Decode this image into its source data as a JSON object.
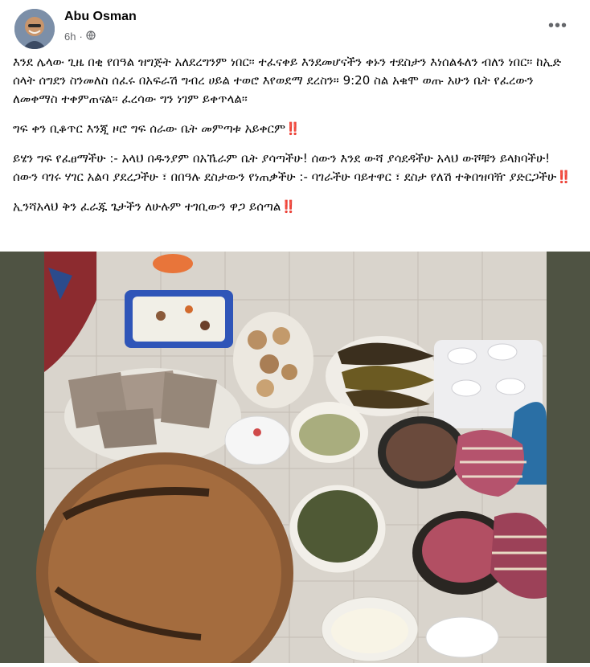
{
  "post": {
    "author": "Abu Osman",
    "time": "6h",
    "dot": "·",
    "audience_icon": "globe-icon",
    "more_icon": "more-options-icon",
    "more_label": "•••",
    "paragraphs": [
      {
        "text": "እንደ ሌላው ጊዜ በቂ የበዓል ዝግጅት አለደረግንም ነበር። ተፈናቀይ እንደመሆናችን ቀኑን ተደስታን እነሰልፋለን ብለን ነበር። ከኢድ ሰላት ሰግደን ስንመለስ ሰፈሩ በአፍራሽ ግብረ ሀይል ተወሮ እየወደማ ደረስን። 9:20 ስል አቁሞ ወጡ አሁን ቤት የፈረውን ለመቀማስ ተቀምጠናል። ፈረሳው ግን ነገም ይቀጥላል።",
        "mark": ""
      },
      {
        "text": "ግፍ ቀን ቢቆጥር እንጂ ዞሮ ግፍ ሰራው ቤት መምጣቱ አይቀርም",
        "mark": "‼️"
      },
      {
        "text": "ይሄን ግፍ የፈፀማችሁ :- አላህ በዱንያም በአኼራም ቤት ያሳጣችሁ! ሰውን እንደ ውሻ ያሳደዳችሁ አላህ ውሾቹን ይላክባችሁ! ሰውን ባገሩ ሃገር አልባ ያደረጋችሁ ፣ በበዓሉ ደስታውን የነጠቃችሁ :- ባገራችሁ ባይተዋር ፣ ደስታ የለሽ ተቅበዝባዥ ያድርጋችሁ",
        "mark": "‼️"
      },
      {
        "text": "ኢንሻአላህ ቅን ፈራጁ ጌታችን ለሁሉም ተገቢውን ዋጋ ይሰጣል",
        "mark": "‼️"
      }
    ],
    "photo_icon": "food-spread-photo"
  }
}
